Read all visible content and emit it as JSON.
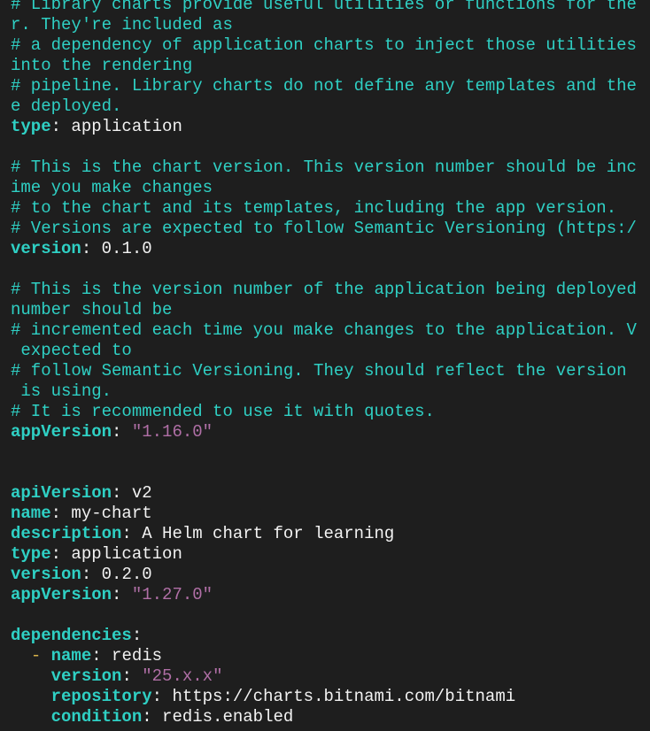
{
  "terminal": {
    "lines": [
      {
        "type": "comment",
        "text": "# Library charts provide useful utilities or functions for the chart developer. They're included as"
      },
      {
        "type": "comment",
        "text": "# a dependency of application charts to inject those utilities and functions into the rendering"
      },
      {
        "type": "comment",
        "text": "# pipeline. Library charts do not define any templates and therefore cannot be deployed."
      },
      {
        "type": "kv",
        "key": "type",
        "value": "application",
        "value_type": "plain"
      },
      {
        "type": "blank"
      },
      {
        "type": "comment",
        "text": "# This is the chart version. This version number should be incremented each time you make changes"
      },
      {
        "type": "comment",
        "text": "# to the chart and its templates, including the app version."
      },
      {
        "type": "comment",
        "text": "# Versions are expected to follow Semantic Versioning (https://semver.org/)"
      },
      {
        "type": "kv",
        "key": "version",
        "value": "0.1.0",
        "value_type": "plain"
      },
      {
        "type": "blank"
      },
      {
        "type": "comment",
        "text": "# This is the version number of the application being deployed. This version number should be"
      },
      {
        "type": "comment",
        "text": "# incremented each time you make changes to the application. Versions are not expected to"
      },
      {
        "type": "comment",
        "text": "# follow Semantic Versioning. They should reflect the version the application is using."
      },
      {
        "type": "comment",
        "text": "# It is recommended to use it with quotes."
      },
      {
        "type": "kv",
        "key": "appVersion",
        "value": "\"1.16.0\"",
        "value_type": "string"
      },
      {
        "type": "blank"
      },
      {
        "type": "blank"
      },
      {
        "type": "blank"
      },
      {
        "type": "kv",
        "key": "apiVersion",
        "value": "v2",
        "value_type": "plain"
      },
      {
        "type": "kv",
        "key": "name",
        "value": "my-chart",
        "value_type": "plain"
      },
      {
        "type": "kv",
        "key": "description",
        "value": "A Helm chart for learning",
        "value_type": "plain"
      },
      {
        "type": "kv",
        "key": "type",
        "value": "application",
        "value_type": "plain"
      },
      {
        "type": "kv",
        "key": "version",
        "value": "0.2.0",
        "value_type": "plain"
      },
      {
        "type": "kv",
        "key": "appVersion",
        "value": "\"1.27.0\"",
        "value_type": "string"
      },
      {
        "type": "blank"
      },
      {
        "type": "kv",
        "key": "dependencies",
        "value": "",
        "value_type": "plain"
      },
      {
        "type": "kv",
        "indent": "  ",
        "dash": "- ",
        "key": "name",
        "value": "redis",
        "value_type": "plain"
      },
      {
        "type": "kv",
        "indent": "    ",
        "key": "version",
        "value": "\"25.x.x\"",
        "value_type": "string"
      },
      {
        "type": "kv",
        "indent": "    ",
        "key": "repository",
        "value": "https://charts.bitnami.com/bitnami",
        "value_type": "plain"
      },
      {
        "type": "kv",
        "indent": "    ",
        "key": "condition",
        "value": "redis.enabled",
        "value_type": "plain"
      }
    ],
    "wrapped_comments": [
      {
        "first": "# Library charts provide useful utilities or functions for the",
        "rest": "r. They're included as"
      },
      {
        "first": "# a dependency of application charts to inject those utilities",
        "rest": "into the rendering"
      },
      {
        "first": "# pipeline. Library charts do not define any templates and the",
        "rest": "e deployed."
      },
      {
        "first": "# This is the chart version. This version number should be inc",
        "rest": "ime you make changes"
      },
      {
        "first": "# to the chart and its templates, including the app version.",
        "rest": ""
      },
      {
        "first": "# Versions are expected to follow Semantic Versioning (https:/",
        "rest": ""
      },
      {
        "first": "# This is the version number of the application being deployed",
        "rest": "number should be"
      },
      {
        "first": "# incremented each time you make changes to the application. V",
        "rest": " expected to"
      },
      {
        "first": "# follow Semantic Versioning. They should reflect the version",
        "rest": " is using."
      },
      {
        "first": "# It is recommended to use it with quotes.",
        "rest": ""
      }
    ],
    "colors": {
      "background": "#1e1e1e",
      "comment": "#2fd0c4",
      "key": "#2fd0c4",
      "text": "#f2f2f2",
      "string": "#b06fa6",
      "dash": "#d8b24a"
    }
  }
}
